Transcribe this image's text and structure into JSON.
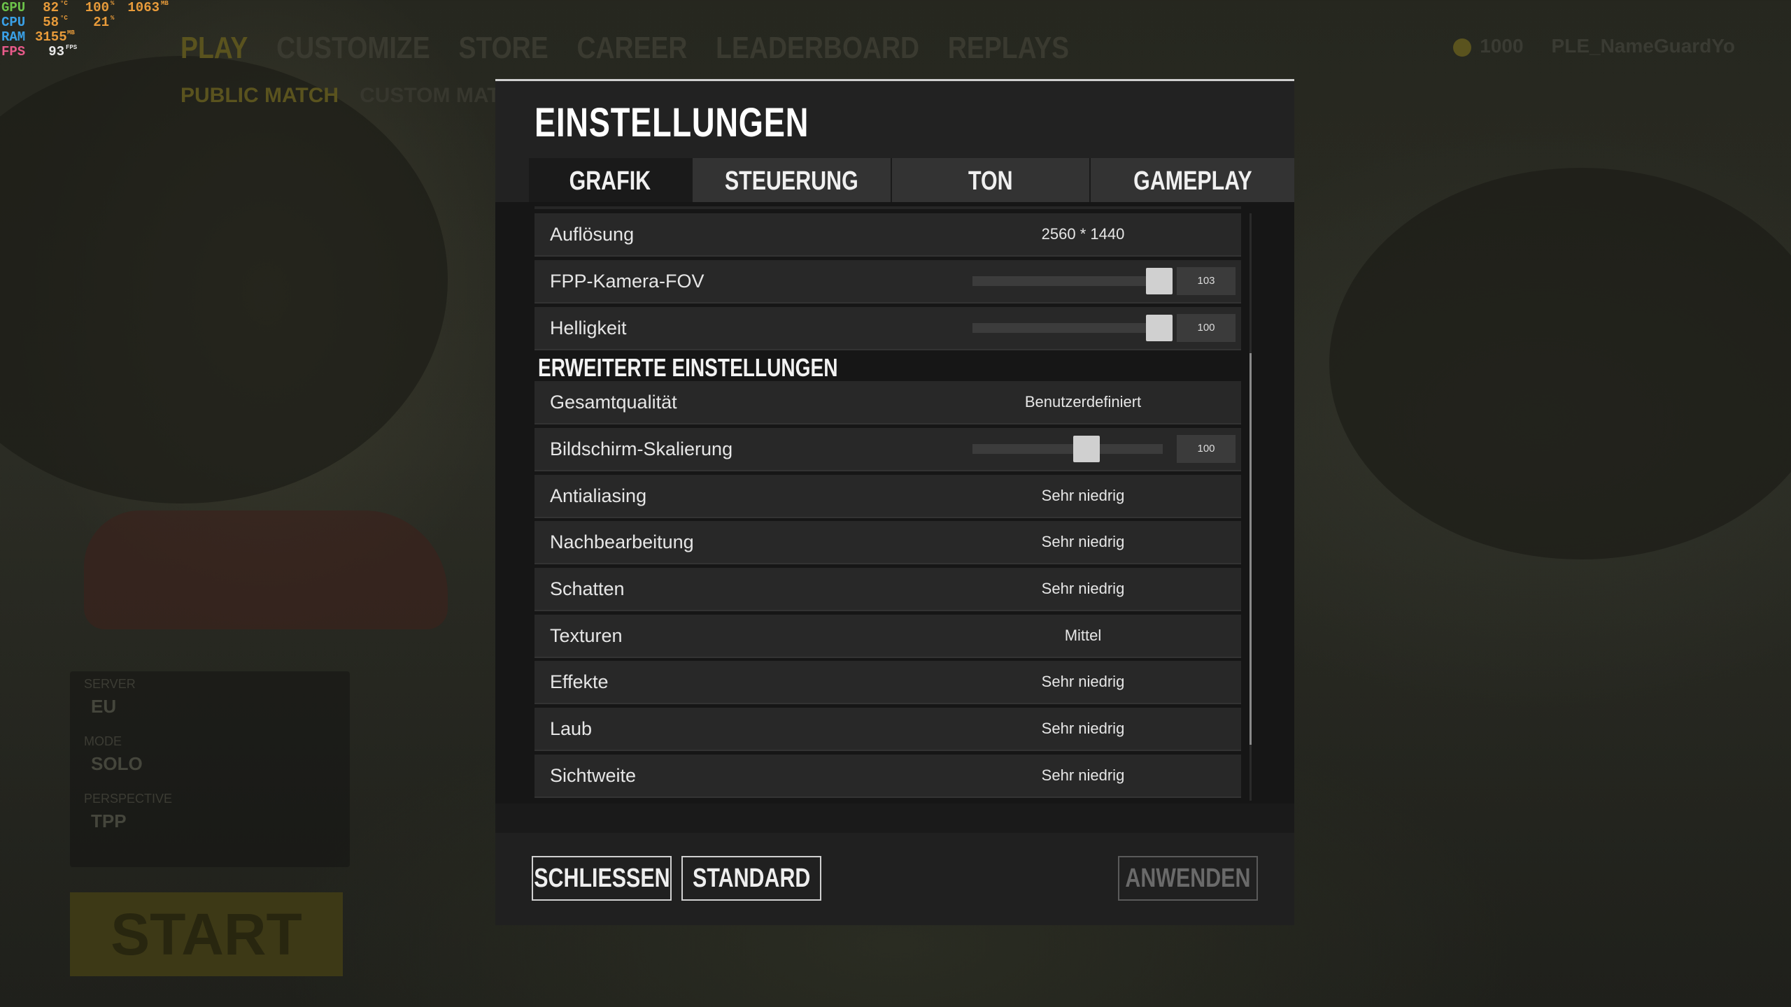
{
  "hud": {
    "gpu_label": "GPU",
    "gpu_temp": "82",
    "gpu_temp_unit": "°C",
    "gpu_load": "100",
    "gpu_load_unit": "%",
    "gpu_mem": "1063",
    "gpu_mem_unit": "MB",
    "cpu_label": "CPU",
    "cpu_temp": "58",
    "cpu_temp_unit": "°C",
    "cpu_load": "21",
    "cpu_load_unit": "%",
    "ram_label": "RAM",
    "ram_value": "3155",
    "ram_unit": "MB",
    "fps_label": "FPS",
    "fps_value": "93",
    "fps_unit": "FPS"
  },
  "background": {
    "nav": [
      "PLAY",
      "CUSTOMIZE",
      "STORE",
      "CAREER",
      "LEADERBOARD",
      "REPLAYS"
    ],
    "subnav": [
      "PUBLIC MATCH",
      "CUSTOM MATCH"
    ],
    "bp": "1000",
    "player": "PLE_NameGuardYo",
    "panel_labels": [
      "SERVER",
      "MODE",
      "PERSPECTIVE"
    ],
    "panel_values": [
      "EU",
      "SOLO",
      "TPP"
    ],
    "start": "START"
  },
  "dialog": {
    "title": "EINSTELLUNGEN",
    "tabs": [
      {
        "label": "GRAFIK",
        "active": true
      },
      {
        "label": "STEUERUNG",
        "active": false
      },
      {
        "label": "TON",
        "active": false
      },
      {
        "label": "GAMEPLAY",
        "active": false
      }
    ],
    "basic": {
      "resolution": {
        "label": "Auflösung",
        "value": "2560 * 1440"
      },
      "fov": {
        "label": "FPP-Kamera-FOV",
        "value": "103",
        "fill": 0.98
      },
      "brightness": {
        "label": "Helligkeit",
        "value": "100",
        "fill": 0.98
      }
    },
    "advanced_title": "ERWEITERTE EINSTELLUNGEN",
    "advanced": {
      "overall": {
        "label": "Gesamtqualität",
        "value": "Benutzerdefiniert"
      },
      "scaling": {
        "label": "Bildschirm-Skalierung",
        "value": "100",
        "fill": 0.6
      },
      "antialiasing": {
        "label": "Antialiasing",
        "value": "Sehr niedrig"
      },
      "postprocessing": {
        "label": "Nachbearbeitung",
        "value": "Sehr niedrig"
      },
      "shadows": {
        "label": "Schatten",
        "value": "Sehr niedrig"
      },
      "textures": {
        "label": "Texturen",
        "value": "Mittel"
      },
      "effects": {
        "label": "Effekte",
        "value": "Sehr niedrig"
      },
      "foliage": {
        "label": "Laub",
        "value": "Sehr niedrig"
      },
      "view_distance": {
        "label": "Sichtweite",
        "value": "Sehr niedrig"
      }
    },
    "buttons": {
      "close": "SCHLIESSEN",
      "default": "STANDARD",
      "apply": "ANWENDEN"
    }
  }
}
